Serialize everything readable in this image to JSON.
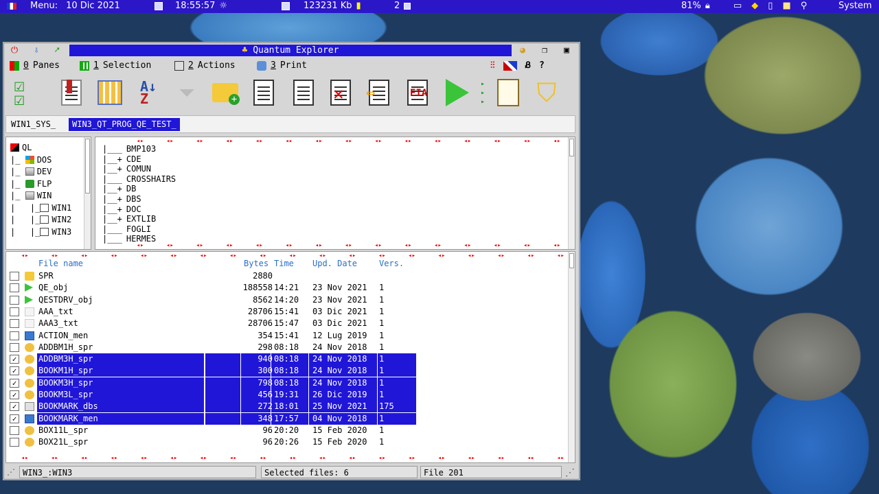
{
  "topbar": {
    "menu_label": "Menu:",
    "date": "10 Dic 2021",
    "time": "18:55:57",
    "memory": "123231 Kb",
    "jobs": "2",
    "battery": "81%",
    "system_label": "System"
  },
  "window": {
    "title": "Quantum Explorer"
  },
  "menu": [
    {
      "num": "0",
      "label": "Panes"
    },
    {
      "num": "1",
      "label": "Selection"
    },
    {
      "num": "2",
      "label": "Actions"
    },
    {
      "num": "3",
      "label": "Print"
    }
  ],
  "paths": {
    "path1": "WIN1_SYS_",
    "path2": "WIN3_QT_PROG_QE_TEST_"
  },
  "tree": [
    {
      "prefix": "",
      "label": "QL",
      "icon": "ql-icon"
    },
    {
      "prefix": "|_ ",
      "label": "DOS",
      "icon": "windows-icon"
    },
    {
      "prefix": "|_ ",
      "label": "DEV",
      "icon": "drive-icon"
    },
    {
      "prefix": "|_ ",
      "label": "FLP",
      "icon": "floppy-icon"
    },
    {
      "prefix": "|_ ",
      "label": "WIN",
      "icon": "drive-icon"
    },
    {
      "prefix": "|   |_",
      "label": "WIN1",
      "icon": "chart-icon"
    },
    {
      "prefix": "|   |_",
      "label": "WIN2",
      "icon": "chart-icon"
    },
    {
      "prefix": "|   |_",
      "label": "WIN3",
      "icon": "chart-icon"
    }
  ],
  "dirs": [
    {
      "prefix": "|___",
      "label": "BMP103"
    },
    {
      "prefix": "|__+",
      "label": "CDE"
    },
    {
      "prefix": "|__+",
      "label": "COMUN"
    },
    {
      "prefix": "|___",
      "label": "CROSSHAIRS"
    },
    {
      "prefix": "|__+",
      "label": "DB"
    },
    {
      "prefix": "|__+",
      "label": "DBS"
    },
    {
      "prefix": "|__+",
      "label": "DOC"
    },
    {
      "prefix": "|__+",
      "label": "EXTLIB"
    },
    {
      "prefix": "|___",
      "label": "FOGLI"
    },
    {
      "prefix": "|___",
      "label": "HERMES"
    }
  ],
  "files_header": {
    "name": "File name",
    "bytes": "Bytes",
    "time": "Time",
    "date": "Upd. Date",
    "vers": "Vers."
  },
  "files": [
    {
      "name": "SPR",
      "bytes": "2880",
      "time": "",
      "date": "",
      "vers": "",
      "icon": "folder-icon",
      "sel": false
    },
    {
      "name": "QE_obj",
      "bytes": "188558",
      "time": "14:21",
      "date": "23 Nov 2021",
      "vers": "1",
      "icon": "play-icon",
      "sel": false
    },
    {
      "name": "QESTDRV_obj",
      "bytes": "8562",
      "time": "14:20",
      "date": "23 Nov 2021",
      "vers": "1",
      "icon": "play-icon",
      "sel": false
    },
    {
      "name": "AAA_txt",
      "bytes": "28706",
      "time": "15:41",
      "date": "03 Dic 2021",
      "vers": "1",
      "icon": "text-icon",
      "sel": false
    },
    {
      "name": "AAA3_txt",
      "bytes": "28706",
      "time": "15:47",
      "date": "03 Dic 2021",
      "vers": "1",
      "icon": "text-icon",
      "sel": false
    },
    {
      "name": "ACTION_men",
      "bytes": "354",
      "time": "15:41",
      "date": "12 Lug 2019",
      "vers": "1",
      "icon": "menu-icon",
      "sel": false
    },
    {
      "name": "ADDBM1H_spr",
      "bytes": "298",
      "time": "08:18",
      "date": "24 Nov 2018",
      "vers": "1",
      "icon": "palette-icon",
      "sel": false
    },
    {
      "name": "ADDBM3H_spr",
      "bytes": "940",
      "time": "08:18",
      "date": "24 Nov 2018",
      "vers": "1",
      "icon": "palette-icon",
      "sel": true
    },
    {
      "name": "BOOKM1H_spr",
      "bytes": "300",
      "time": "08:18",
      "date": "24 Nov 2018",
      "vers": "1",
      "icon": "palette-icon",
      "sel": true
    },
    {
      "name": "BOOKM3H_spr",
      "bytes": "798",
      "time": "08:18",
      "date": "24 Nov 2018",
      "vers": "1",
      "icon": "palette-icon",
      "sel": true
    },
    {
      "name": "BOOKM3L_spr",
      "bytes": "456",
      "time": "19:31",
      "date": "26 Dic 2019",
      "vers": "1",
      "icon": "palette-icon",
      "sel": true
    },
    {
      "name": "BOOKMARK_dbs",
      "bytes": "272",
      "time": "18:01",
      "date": "25 Nov 2021",
      "vers": "175",
      "icon": "db-icon",
      "sel": true
    },
    {
      "name": "BOOKMARK_men",
      "bytes": "348",
      "time": "17:57",
      "date": "04 Nov 2018",
      "vers": "1",
      "icon": "menu-icon",
      "sel": true
    },
    {
      "name": "BOX11L_spr",
      "bytes": "96",
      "time": "20:20",
      "date": "15 Feb 2020",
      "vers": "1",
      "icon": "palette-icon",
      "sel": false
    },
    {
      "name": "BOX21L_spr",
      "bytes": "96",
      "time": "20:26",
      "date": "15 Feb 2020",
      "vers": "1",
      "icon": "palette-icon",
      "sel": false
    }
  ],
  "status": {
    "path": "WIN3_:WIN3",
    "selected": "Selected files: 6",
    "count": "File 201"
  },
  "colors": {
    "selection": "#2016d8",
    "header_text": "#2a6fc8",
    "arrows": "#e00000"
  }
}
